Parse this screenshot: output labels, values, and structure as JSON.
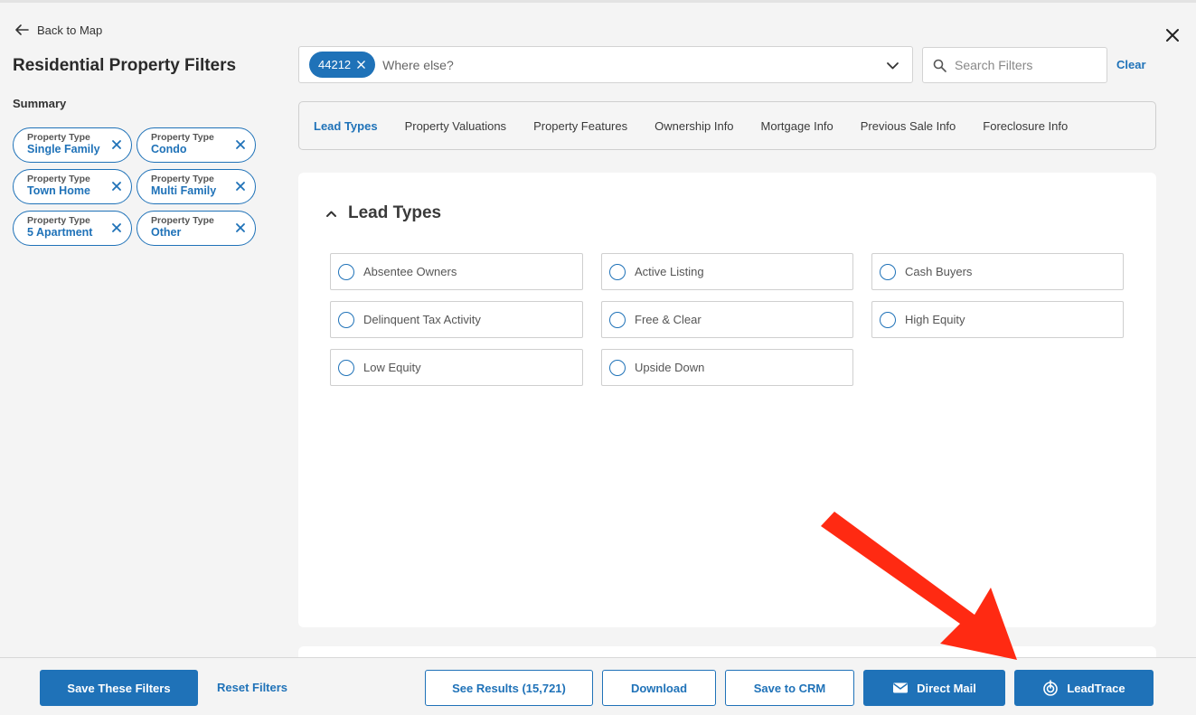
{
  "nav": {
    "back_label": "Back to Map"
  },
  "page": {
    "title": "Residential Property Filters",
    "summary_label": "Summary"
  },
  "summary_chips": [
    {
      "label": "Property Type",
      "value": "Single Family"
    },
    {
      "label": "Property Type",
      "value": "Condo"
    },
    {
      "label": "Property Type",
      "value": "Town Home"
    },
    {
      "label": "Property Type",
      "value": "Multi Family"
    },
    {
      "label": "Property Type",
      "value": "5 Apartment"
    },
    {
      "label": "Property Type",
      "value": "Other"
    }
  ],
  "location": {
    "chip": "44212",
    "placeholder": "Where else?"
  },
  "search": {
    "placeholder": "Search Filters",
    "clear_label": "Clear"
  },
  "tabs": [
    {
      "label": "Lead Types",
      "active": true
    },
    {
      "label": "Property Valuations"
    },
    {
      "label": "Property Features"
    },
    {
      "label": "Ownership Info"
    },
    {
      "label": "Mortgage Info"
    },
    {
      "label": "Previous Sale Info"
    },
    {
      "label": "Foreclosure Info"
    }
  ],
  "section": {
    "title": "Lead Types",
    "options": [
      "Absentee Owners",
      "Active Listing",
      "Cash Buyers",
      "Delinquent Tax Activity",
      "Free & Clear",
      "High Equity",
      "Low Equity",
      "Upside Down"
    ]
  },
  "footer": {
    "save_filters": "Save These Filters",
    "reset_filters": "Reset Filters",
    "see_results": "See Results (15,721)",
    "download": "Download",
    "save_crm": "Save to CRM",
    "direct_mail": "Direct Mail",
    "leadtrace": "LeadTrace"
  },
  "colors": {
    "accent": "#1f72b8",
    "annotation_arrow": "#ff2a12"
  }
}
